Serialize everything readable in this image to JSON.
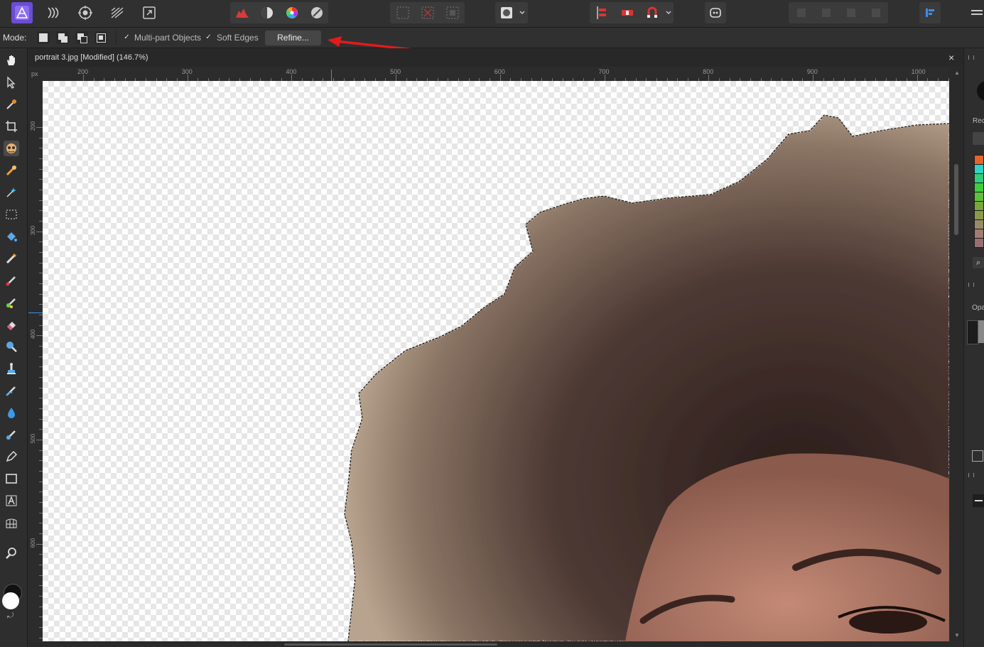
{
  "context_toolbar": {
    "mode_label": "Mode:",
    "multipart_label": "Multi-part Objects",
    "multipart_checked": true,
    "soft_edges_label": "Soft Edges",
    "soft_edges_checked": true,
    "refine_label": "Refine..."
  },
  "document": {
    "tab_title": "portrait 3.jpg [Modified] (146.7%)",
    "close_glyph": "×"
  },
  "ruler": {
    "unit": "px",
    "top_ticks": [
      "200",
      "300",
      "400",
      "500",
      "600",
      "700",
      "800",
      "900",
      "1000"
    ],
    "left_ticks": [
      "200",
      "300",
      "400",
      "500",
      "600"
    ]
  },
  "right_panel": {
    "label_rec": "Rec",
    "label_opa": "Opa",
    "swatches": [
      "#e8632a",
      "#2fd3c8",
      "#2fcf7a",
      "#3fcc3f",
      "#5cc23a",
      "#7aa53a",
      "#8a9a4a",
      "#9a8a6a",
      "#a07c72",
      "#9a6e6e"
    ]
  },
  "annotation": {
    "color": "#e01b1b"
  },
  "icons": {
    "top": [
      "persona-photo-icon",
      "persona-liquify-icon",
      "persona-develop-icon",
      "persona-tone-mapping-icon",
      "persona-export-icon",
      "histogram-icon",
      "auto-levels-icon",
      "color-wheel-icon",
      "white-balance-icon",
      "quick-mask-off-icon",
      "quick-mask-clear-icon",
      "selection-mode-icon",
      "mask-icon",
      "align-icon",
      "snap-toggle-icon",
      "snapping-icon",
      "assistant-icon",
      "arrange-1-icon",
      "arrange-2-icon",
      "arrange-3-icon",
      "arrange-4-icon",
      "panel-toggle-icon"
    ],
    "left": [
      "hand-icon",
      "move-icon",
      "color-picker-icon",
      "crop-icon",
      "selection-brush-icon",
      "flood-select-icon",
      "freehand-select-icon",
      "marquee-icon",
      "fill-icon",
      "paint-brush-icon",
      "pixel-icon",
      "paint-mixer-icon",
      "erase-icon",
      "dodge-icon",
      "clone-icon",
      "smudge-icon",
      "blur-icon",
      "healing-icon",
      "pen-icon",
      "rectangle-icon",
      "text-icon",
      "mesh-warp-icon",
      "zoom-icon"
    ]
  }
}
